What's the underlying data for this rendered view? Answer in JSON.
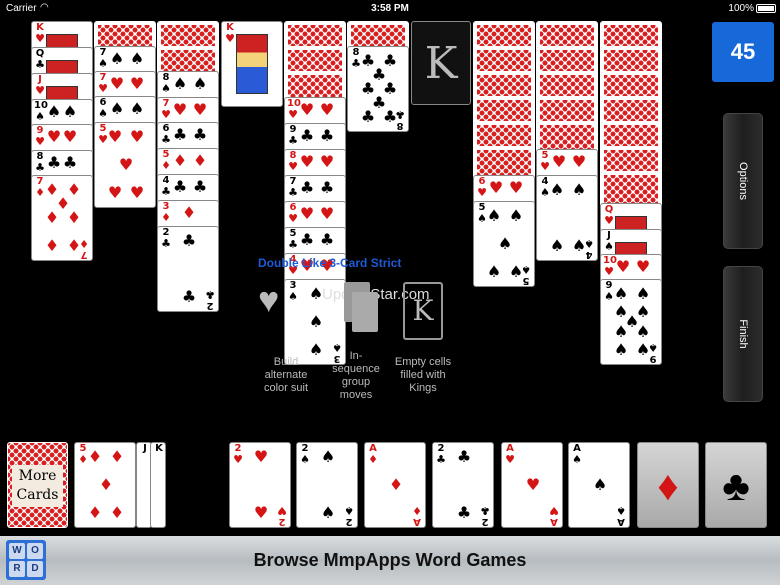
{
  "status_bar": {
    "carrier": "Carrier",
    "time": "3:58 PM",
    "battery": "100%"
  },
  "score": "45",
  "side_buttons": {
    "options": "Options",
    "finish": "Finish"
  },
  "empty_king_slot": "K",
  "overlay": {
    "title": "Double Like 3-Card Strict",
    "url": "UpdateStar.com",
    "k_glyph": "K",
    "captions": {
      "build": "Build alternate color suit",
      "sequence": "In-sequence group moves",
      "empty": "Empty cells filled with Kings"
    }
  },
  "more_cards_label": "More Cards",
  "ad_bar": {
    "title": "Browse MmpApps Word Games",
    "logo_letters": [
      "W",
      "O",
      "R",
      "D"
    ]
  },
  "colors": {
    "score_bg": "#1769d9",
    "card_red": "#d41515",
    "overlay_title": "#1d5bd6"
  },
  "cards": {
    "c1": [
      "K",
      "Q",
      "J",
      "10",
      "9",
      "8",
      "7"
    ],
    "c2": [
      "7",
      "7",
      "6",
      "5"
    ],
    "c3": [
      "8",
      "7",
      "6",
      "5",
      "4",
      "3",
      "2"
    ],
    "c4": [
      "K"
    ],
    "c5": [
      "10",
      "9",
      "8",
      "7",
      "6",
      "5",
      "4",
      "3"
    ],
    "c6": [
      "8"
    ],
    "c8": [
      "6",
      "5"
    ],
    "c9": [
      "5",
      "4"
    ],
    "c10": [
      "Q",
      "J",
      "10",
      "9"
    ],
    "waste": [
      "5",
      "J",
      "K"
    ],
    "foundations": [
      "2",
      "2",
      "A",
      "2",
      "A",
      "A"
    ]
  }
}
